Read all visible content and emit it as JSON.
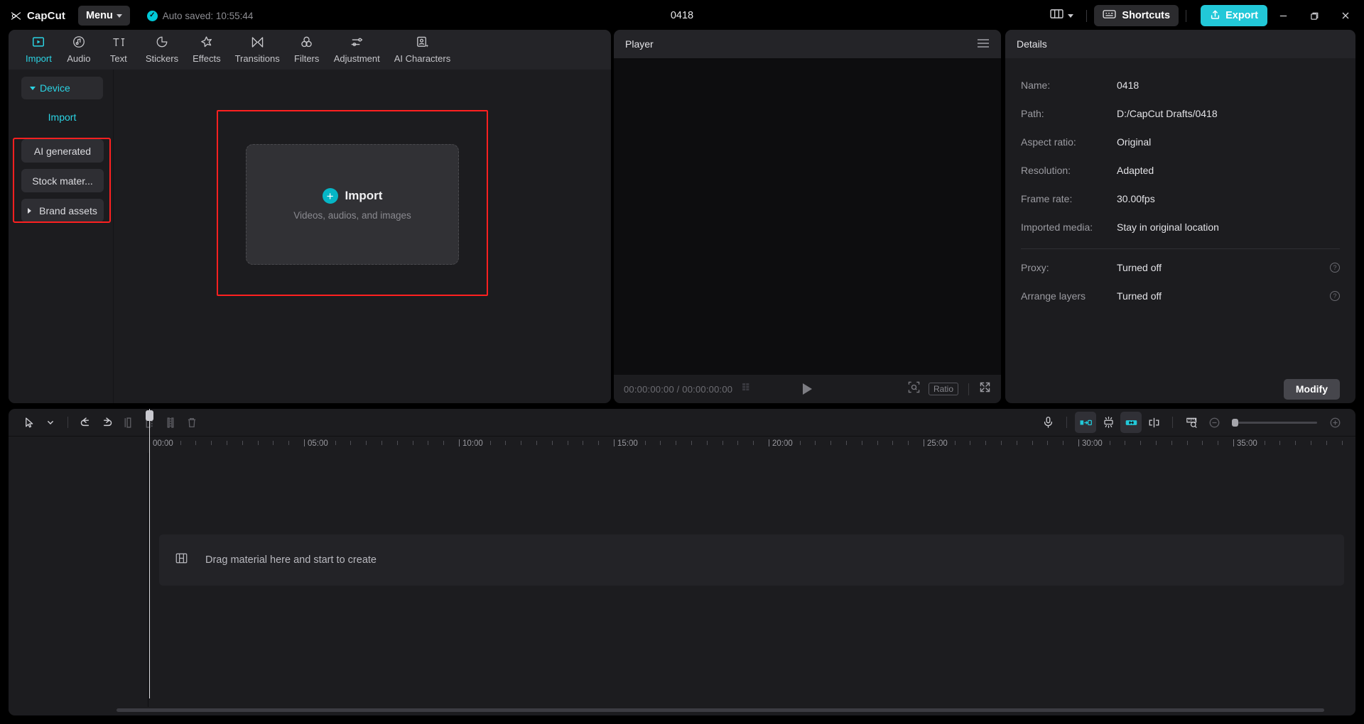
{
  "titlebar": {
    "brand": "CapCut",
    "menu_label": "Menu",
    "autosave_text": "Auto saved: 10:55:44",
    "project_title": "0418",
    "shortcuts_label": "Shortcuts",
    "export_label": "Export",
    "accent": "#22c8d8"
  },
  "toolbar": {
    "tabs": [
      {
        "label": "Import",
        "icon": "import-icon",
        "active": true
      },
      {
        "label": "Audio",
        "icon": "audio-note-icon",
        "active": false
      },
      {
        "label": "Text",
        "icon": "text-ti-icon",
        "active": false
      },
      {
        "label": "Stickers",
        "icon": "sticker-drop-icon",
        "active": false
      },
      {
        "label": "Effects",
        "icon": "effects-star-icon",
        "active": false
      },
      {
        "label": "Transitions",
        "icon": "transitions-bowtie-icon",
        "active": false
      },
      {
        "label": "Filters",
        "icon": "filters-circles-icon",
        "active": false
      },
      {
        "label": "Adjustment",
        "icon": "adjustment-sliders-icon",
        "active": false
      },
      {
        "label": "AI Characters",
        "icon": "ai-characters-icon",
        "active": false
      }
    ]
  },
  "sidebar": {
    "device_label": "Device",
    "import_label": "Import",
    "items": [
      {
        "label": "AI generated",
        "expandable": false
      },
      {
        "label": "Stock mater...",
        "expandable": false
      },
      {
        "label": "Brand assets",
        "expandable": true
      }
    ],
    "highlight_color": "#ff2020"
  },
  "import_area": {
    "button_label": "Import",
    "subtitle": "Videos, audios, and images",
    "plus_icon": "plus-circle-icon",
    "highlight_color": "#ff2020"
  },
  "player": {
    "title": "Player",
    "menu_icon": "hamburger-icon",
    "current_time": "00:00:00:00",
    "total_time": "00:00:00:00",
    "time_display": "00:00:00:00 / 00:00:00:00",
    "ratio_label": "Ratio",
    "play_icon": "play-icon",
    "zoom_icon": "magnifier-frame-icon",
    "fullscreen_icon": "fullscreen-icon",
    "grid_icon": "grid-icon"
  },
  "details": {
    "title": "Details",
    "rows": [
      {
        "key": "Name:",
        "value": "0418",
        "help": false
      },
      {
        "key": "Path:",
        "value": "D:/CapCut Drafts/0418",
        "help": false
      },
      {
        "key": "Aspect ratio:",
        "value": "Original",
        "help": false
      },
      {
        "key": "Resolution:",
        "value": "Adapted",
        "help": false
      },
      {
        "key": "Frame rate:",
        "value": "30.00fps",
        "help": false
      },
      {
        "key": "Imported media:",
        "value": "Stay in original location",
        "help": false
      }
    ],
    "rows2": [
      {
        "key": "Proxy:",
        "value": "Turned off",
        "help": true
      },
      {
        "key": "Arrange layers",
        "value": "Turned off",
        "help": true
      }
    ],
    "modify_label": "Modify"
  },
  "timeline": {
    "tools_left": [
      {
        "name": "select-cursor-icon",
        "state": "normal"
      },
      {
        "name": "chevron-down-icon",
        "state": "normal"
      },
      {
        "name": "undo-icon",
        "state": "normal"
      },
      {
        "name": "redo-icon",
        "state": "normal"
      },
      {
        "name": "split-left-icon",
        "state": "dim"
      },
      {
        "name": "split-right-icon",
        "state": "dim"
      },
      {
        "name": "split-icon",
        "state": "dim"
      },
      {
        "name": "delete-icon",
        "state": "dim"
      }
    ],
    "tools_right": [
      {
        "name": "microphone-icon",
        "state": "normal"
      },
      {
        "name": "mirror-icon",
        "state": "on"
      },
      {
        "name": "snap-icon",
        "state": "normal"
      },
      {
        "name": "link-icon",
        "state": "on"
      },
      {
        "name": "trim-icon",
        "state": "normal"
      },
      {
        "name": "ruler-icon",
        "state": "normal"
      },
      {
        "name": "zoom-out-icon",
        "state": "dim"
      },
      {
        "name": "zoom-in-icon",
        "state": "dim"
      }
    ],
    "ruler_labels": [
      "00:00",
      "05:00",
      "10:00",
      "15:00",
      "20:00",
      "25:00",
      "30:00",
      "35:00"
    ],
    "ruler_spacing_px": 218,
    "placeholder_text": "Drag material here and start to create",
    "placeholder_icon": "film-strip-icon"
  }
}
